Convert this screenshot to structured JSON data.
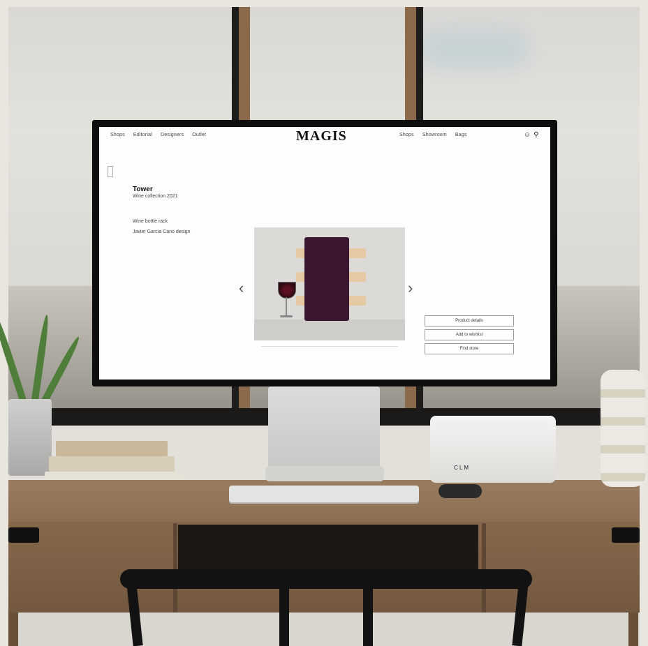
{
  "site": {
    "nav_left": [
      "Shops",
      "Editorial",
      "Designers",
      "Outlet"
    ],
    "logo": "MAGIS",
    "nav_right": [
      "Shops",
      "Showroom",
      "Bags"
    ],
    "nav_icons": [
      "user-icon",
      "search-icon"
    ]
  },
  "product": {
    "title": "Tower",
    "subtitle": "Wine collection 2021",
    "desc_line1": "Wine bottle rack",
    "desc_line2": "Javier Garcia Cano design"
  },
  "gallery": {
    "caption": "",
    "prev_label": "‹",
    "next_label": "›"
  },
  "actions": {
    "buttons": [
      "Product details",
      "Add to wishlist",
      "Find store"
    ]
  },
  "speaker": {
    "label": "C L M"
  }
}
